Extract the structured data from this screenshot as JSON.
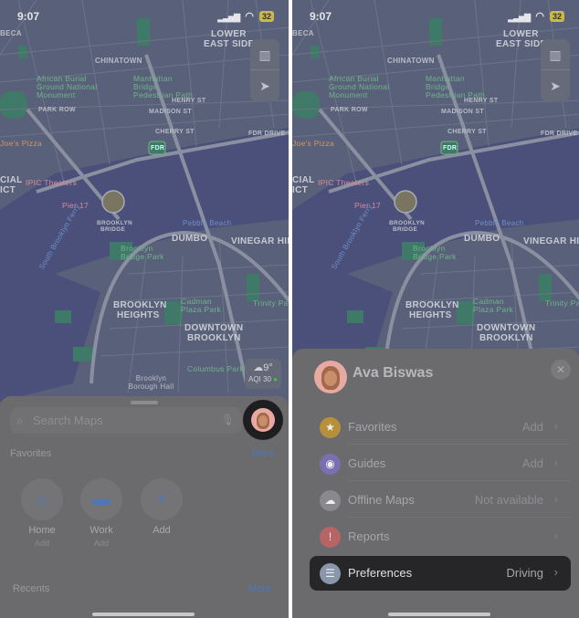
{
  "status": {
    "time": "9:07",
    "battery": "32"
  },
  "map": {
    "labels": {
      "tribeca": "BECA",
      "lower_east_side_1": "LOWER",
      "lower_east_side_2": "EAST SIDE",
      "chinatown": "CHINATOWN",
      "african_burial": "African Burial Ground National Monument",
      "manhattan_bridge": "Manhattan Bridge Pedestrian Path",
      "henry_st": "HENRY ST",
      "madison_st": "MADISON ST",
      "cherry_st": "CHERRY ST",
      "fdr_drive": "FDR DRIVE",
      "fdr": "FDR",
      "joes_pizza": "Joe's Pizza",
      "financial_1": "CIAL",
      "financial_2": "ICT",
      "ipic": "IPIC Theaters",
      "pier17": "Pier 17",
      "brooklyn_bridge_1": "BROOKLYN",
      "brooklyn_bridge_2": "BRIDGE",
      "pebble_beach": "Pebble Beach",
      "dumbo": "DUMBO",
      "vinegar_hill": "VINEGAR HILL",
      "bb_park": "Brooklyn Bridge Park",
      "south_brooklyn_ferry": "South Brooklyn Ferry",
      "cadman": "Cadman Plaza Park",
      "trinity": "Trinity Park",
      "brooklyn_heights_1": "BROOKLYN",
      "brooklyn_heights_2": "HEIGHTS",
      "downtown_1": "DOWNTOWN",
      "downtown_2": "BROOKLYN",
      "columbus": "Columbus Park",
      "borough_hall": "Brooklyn Borough Hall",
      "park_row": "PARK ROW"
    },
    "weather": {
      "temp": "9°",
      "aqi": "AQI 30"
    }
  },
  "left_sheet": {
    "search_placeholder": "Search Maps",
    "favorites_title": "Favorites",
    "favorites_more": "More",
    "favorites": [
      {
        "label": "Home",
        "sub": "Add",
        "icon": "house-icon"
      },
      {
        "label": "Work",
        "sub": "Add",
        "icon": "briefcase-icon"
      },
      {
        "label": "Add",
        "icon": "plus-icon"
      }
    ],
    "recents_title": "Recents",
    "recents_more": "More"
  },
  "right_sheet": {
    "user_name": "Ava Biswas",
    "items": [
      {
        "label": "Favorites",
        "value": "Add",
        "icon": "star-icon",
        "color": "#b8903a"
      },
      {
        "label": "Guides",
        "value": "Add",
        "icon": "guides-icon",
        "color": "#7a6fb0"
      },
      {
        "label": "Offline Maps",
        "value": "Not available",
        "icon": "offline-maps-icon",
        "color": "#8a8a8e"
      },
      {
        "label": "Reports",
        "value": "",
        "icon": "reports-icon",
        "color": "#b86464"
      },
      {
        "label": "Preferences",
        "value": "Driving",
        "icon": "preferences-icon",
        "color": "#8a96aa",
        "selected": true
      }
    ]
  }
}
